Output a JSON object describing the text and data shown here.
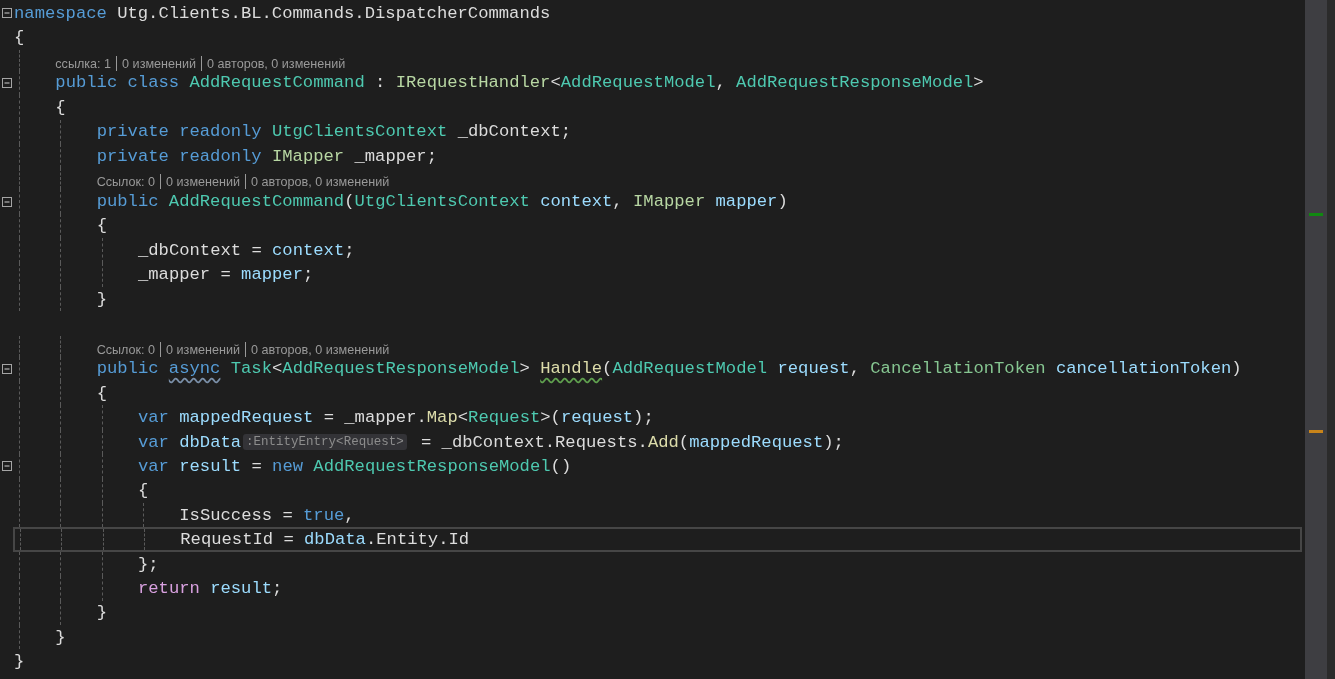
{
  "lines": [
    {
      "kind": "code",
      "fold": true,
      "current": false,
      "tokens": [
        {
          "text": "namespace",
          "kind": "kw"
        },
        {
          "text": " Utg.Clients.BL.Commands.DispatcherCommands",
          "kind": "plain"
        }
      ]
    },
    {
      "kind": "code",
      "fold": false,
      "current": false,
      "tokens": [
        {
          "text": "{",
          "kind": "plain"
        }
      ]
    },
    {
      "kind": "lens",
      "items": [
        "ссылка: 1",
        "0 изменений",
        "0 авторов, 0 изменений"
      ]
    },
    {
      "kind": "code",
      "fold": true,
      "current": false,
      "tokens": [
        {
          "text": "    public class ",
          "kind": "kw"
        },
        {
          "text": "AddRequestCommand",
          "kind": "type"
        },
        {
          "text": " : ",
          "kind": "plain"
        },
        {
          "text": "IRequestHandler",
          "kind": "iface"
        },
        {
          "text": "<",
          "kind": "plain"
        },
        {
          "text": "AddRequestModel",
          "kind": "type"
        },
        {
          "text": ", ",
          "kind": "plain"
        },
        {
          "text": "AddRequestResponseModel",
          "kind": "type"
        },
        {
          "text": ">",
          "kind": "plain"
        }
      ]
    },
    {
      "kind": "code",
      "fold": false,
      "current": false,
      "tokens": [
        {
          "text": "    {",
          "kind": "plain"
        }
      ]
    },
    {
      "kind": "code",
      "fold": false,
      "current": false,
      "tokens": [
        {
          "text": "        private readonly ",
          "kind": "kw"
        },
        {
          "text": "UtgClientsContext",
          "kind": "type"
        },
        {
          "text": " _dbContext;",
          "kind": "plain"
        }
      ]
    },
    {
      "kind": "code",
      "fold": false,
      "current": false,
      "tokens": [
        {
          "text": "        private readonly ",
          "kind": "kw"
        },
        {
          "text": "IMapper",
          "kind": "iface"
        },
        {
          "text": " _mapper;",
          "kind": "plain"
        }
      ]
    },
    {
      "kind": "lens",
      "items": [
        "Ссылок: 0",
        "0 изменений",
        "0 авторов, 0 изменений"
      ]
    },
    {
      "kind": "code",
      "fold": true,
      "current": false,
      "tokens": [
        {
          "text": "        public ",
          "kind": "kw"
        },
        {
          "text": "AddRequestCommand",
          "kind": "type"
        },
        {
          "text": "(",
          "kind": "plain"
        },
        {
          "text": "UtgClientsContext ",
          "kind": "type"
        },
        {
          "text": "context",
          "kind": "param"
        },
        {
          "text": ", ",
          "kind": "plain"
        },
        {
          "text": "IMapper ",
          "kind": "iface"
        },
        {
          "text": "mapper",
          "kind": "param"
        },
        {
          "text": ")",
          "kind": "plain"
        }
      ]
    },
    {
      "kind": "code",
      "fold": false,
      "current": false,
      "tokens": [
        {
          "text": "        {",
          "kind": "plain"
        }
      ]
    },
    {
      "kind": "code",
      "fold": false,
      "current": false,
      "tokens": [
        {
          "text": "            _dbContext = ",
          "kind": "plain"
        },
        {
          "text": "context",
          "kind": "param"
        },
        {
          "text": ";",
          "kind": "plain"
        }
      ]
    },
    {
      "kind": "code",
      "fold": false,
      "current": false,
      "tokens": [
        {
          "text": "            _mapper = ",
          "kind": "plain"
        },
        {
          "text": "mapper",
          "kind": "param"
        },
        {
          "text": ";",
          "kind": "plain"
        }
      ]
    },
    {
      "kind": "code",
      "fold": false,
      "current": false,
      "tokens": [
        {
          "text": "        }",
          "kind": "plain"
        }
      ]
    },
    {
      "kind": "code",
      "fold": false,
      "current": false
    },
    {
      "kind": "lens",
      "items": [
        "Ссылок: 0",
        "0 изменений",
        "0 авторов, 0 изменений"
      ]
    },
    {
      "kind": "code",
      "fold": true,
      "current": false,
      "tokens": [
        {
          "text": "        public ",
          "kind": "kw"
        },
        {
          "text": "async",
          "kind": "kw",
          "squiggle": true
        },
        {
          "text": " Task",
          "kind": "type"
        },
        {
          "text": "<",
          "kind": "plain"
        },
        {
          "text": "AddRequestResponseModel",
          "kind": "type"
        },
        {
          "text": "> ",
          "kind": "plain"
        },
        {
          "text": "Handle",
          "kind": "method",
          "squiggle": true
        },
        {
          "text": "(",
          "kind": "plain"
        },
        {
          "text": "AddRequestModel ",
          "kind": "type"
        },
        {
          "text": "request",
          "kind": "param"
        },
        {
          "text": ", ",
          "kind": "plain"
        },
        {
          "text": "CancellationToken ",
          "kind": "struct"
        },
        {
          "text": "cancellationToken",
          "kind": "param"
        },
        {
          "text": ")",
          "kind": "plain"
        }
      ]
    },
    {
      "kind": "code",
      "fold": false,
      "current": false,
      "tokens": [
        {
          "text": "        {",
          "kind": "plain"
        }
      ]
    },
    {
      "kind": "code",
      "fold": false,
      "current": false,
      "tokens": [
        {
          "text": "            var ",
          "kind": "kw"
        },
        {
          "text": "mappedRequest",
          "kind": "param"
        },
        {
          "text": " = _mapper.",
          "kind": "plain"
        },
        {
          "text": "Map",
          "kind": "method"
        },
        {
          "text": "<",
          "kind": "plain"
        },
        {
          "text": "Request",
          "kind": "type"
        },
        {
          "text": ">(",
          "kind": "plain"
        },
        {
          "text": "request",
          "kind": "param"
        },
        {
          "text": ");",
          "kind": "plain"
        }
      ]
    },
    {
      "kind": "code",
      "fold": false,
      "current": false,
      "tokens": [
        {
          "text": "            var ",
          "kind": "kw"
        },
        {
          "text": "dbData",
          "kind": "param"
        },
        {
          "text": ":EntityEntry<Request>",
          "kind": "hint"
        },
        {
          "text": " = _dbContext.Requests.",
          "kind": "plain"
        },
        {
          "text": "Add",
          "kind": "method"
        },
        {
          "text": "(",
          "kind": "plain"
        },
        {
          "text": "mappedRequest",
          "kind": "param"
        },
        {
          "text": ");",
          "kind": "plain"
        }
      ]
    },
    {
      "kind": "code",
      "fold": true,
      "current": false,
      "tokens": [
        {
          "text": "            var ",
          "kind": "kw"
        },
        {
          "text": "result",
          "kind": "param"
        },
        {
          "text": " = ",
          "kind": "plain"
        },
        {
          "text": "new ",
          "kind": "kw"
        },
        {
          "text": "AddRequestResponseModel",
          "kind": "type"
        },
        {
          "text": "()",
          "kind": "plain"
        }
      ]
    },
    {
      "kind": "code",
      "fold": false,
      "current": false,
      "tokens": [
        {
          "text": "            {",
          "kind": "plain"
        }
      ]
    },
    {
      "kind": "code",
      "fold": false,
      "current": false,
      "tokens": [
        {
          "text": "                IsSuccess = ",
          "kind": "plain"
        },
        {
          "text": "true",
          "kind": "kw"
        },
        {
          "text": ",",
          "kind": "plain"
        }
      ]
    },
    {
      "kind": "code",
      "fold": false,
      "current": true,
      "tokens": [
        {
          "text": "                RequestId = ",
          "kind": "plain"
        },
        {
          "text": "dbData",
          "kind": "param"
        },
        {
          "text": ".Entity.Id",
          "kind": "plain"
        }
      ]
    },
    {
      "kind": "code",
      "fold": false,
      "current": false,
      "tokens": [
        {
          "text": "            };",
          "kind": "plain"
        }
      ]
    },
    {
      "kind": "code",
      "fold": false,
      "current": false,
      "tokens": [
        {
          "text": "            return ",
          "kind": "ctrl"
        },
        {
          "text": "result",
          "kind": "param"
        },
        {
          "text": ";",
          "kind": "plain"
        }
      ]
    },
    {
      "kind": "code",
      "fold": false,
      "current": false,
      "tokens": [
        {
          "text": "        }",
          "kind": "plain"
        }
      ]
    },
    {
      "kind": "code",
      "fold": false,
      "current": false,
      "tokens": [
        {
          "text": "    }",
          "kind": "plain"
        }
      ]
    },
    {
      "kind": "code",
      "fold": false,
      "current": false,
      "tokens": [
        {
          "text": "}",
          "kind": "plain"
        }
      ]
    }
  ]
}
